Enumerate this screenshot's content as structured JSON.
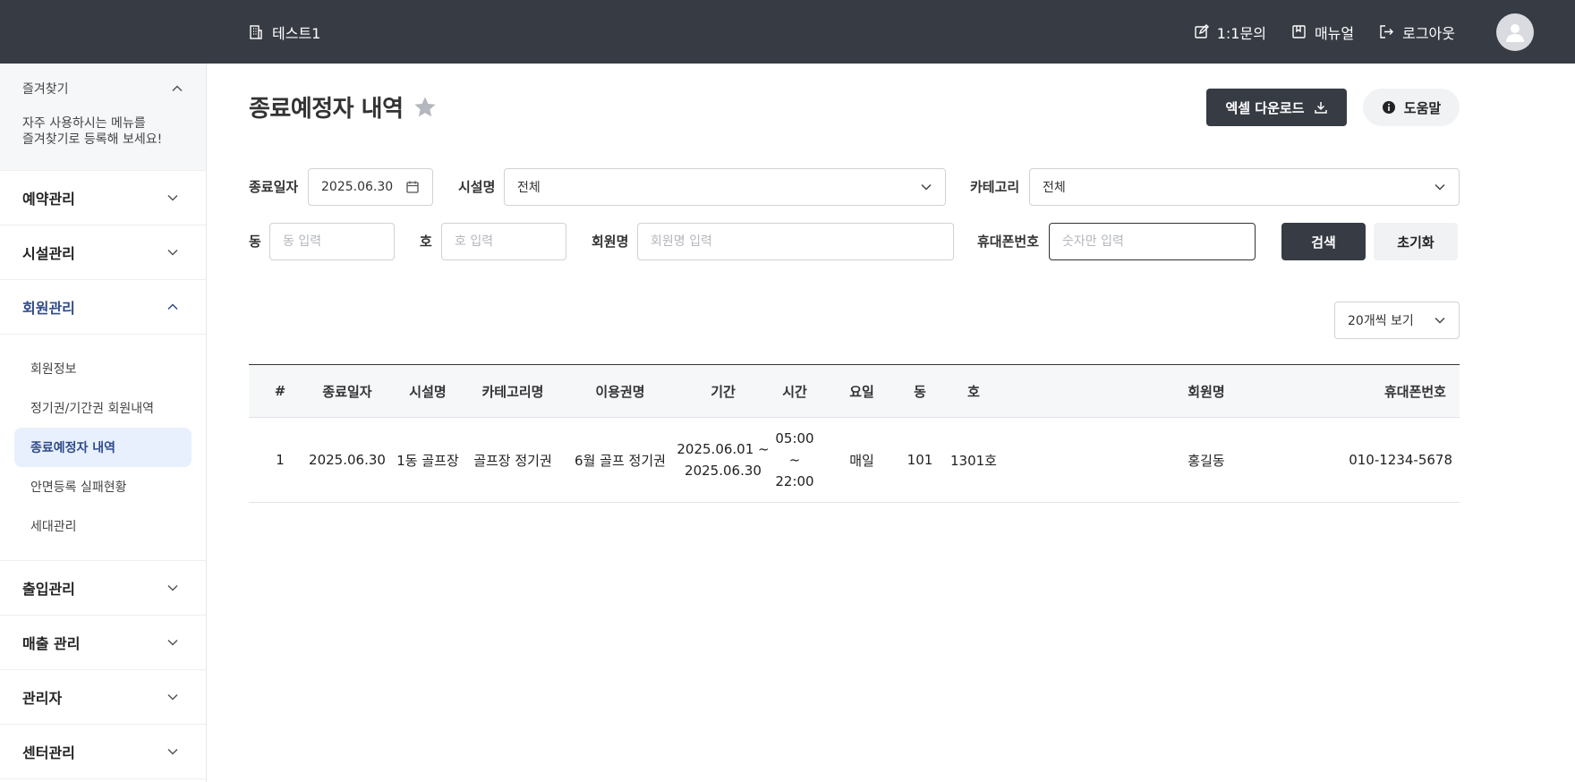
{
  "header": {
    "org_name": "테스트1",
    "inquiry_label": "1:1문의",
    "manual_label": "매뉴얼",
    "logout_label": "로그아웃"
  },
  "sidebar": {
    "favorites_title": "즐겨찾기",
    "favorites_desc_line1": "자주 사용하시는 메뉴를",
    "favorites_desc_line2": "즐겨찾기로 등록해 보세요!",
    "menus": [
      {
        "label": "예약관리"
      },
      {
        "label": "시설관리"
      },
      {
        "label": "회원관리"
      },
      {
        "label": "출입관리"
      },
      {
        "label": "매출 관리"
      },
      {
        "label": "관리자"
      },
      {
        "label": "센터관리"
      }
    ],
    "member_submenu": [
      {
        "label": "회원정보"
      },
      {
        "label": "정기권/기간권 회원내역"
      },
      {
        "label": "종료예정자 내역"
      },
      {
        "label": "안면등록 실패현황"
      },
      {
        "label": "세대관리"
      }
    ]
  },
  "page": {
    "title": "종료예정자 내역",
    "excel_label": "엑셀 다운로드",
    "help_label": "도움말"
  },
  "filters": {
    "end_date_label": "종료일자",
    "end_date_value": "2025.06.30",
    "facility_label": "시설명",
    "facility_value": "전체",
    "category_label": "카테고리",
    "category_value": "전체",
    "dong_label": "동",
    "dong_placeholder": "동 입력",
    "ho_label": "호",
    "ho_placeholder": "호 입력",
    "member_label": "회원명",
    "member_placeholder": "회원명 입력",
    "phone_label": "휴대폰번호",
    "phone_placeholder": "숫자만 입력",
    "search_label": "검색",
    "reset_label": "초기화",
    "page_size_value": "20개씩 보기"
  },
  "table": {
    "headers": [
      "#",
      "종료일자",
      "시설명",
      "카테고리명",
      "이용권명",
      "기간",
      "시간",
      "요일",
      "동",
      "호",
      "회원명",
      "휴대폰번호"
    ],
    "rows": [
      {
        "no": "1",
        "end_date": "2025.06.30",
        "facility": "1동 골프장",
        "category": "골프장 정기권",
        "pass": "6월 골프 정기권",
        "period_start": "2025.06.01 ~",
        "period_end": "2025.06.30",
        "time_start": "05:00 ~",
        "time_end": "22:00",
        "days": "매일",
        "dong": "101",
        "ho": "1301호",
        "member": "홍길동",
        "phone": "010-1234-5678"
      }
    ]
  },
  "colors": {
    "header_bg": "#373b43",
    "active_menu": "#2f4a8a",
    "active_sub_bg": "#e8f0fd",
    "star": "#b4b7bd"
  }
}
